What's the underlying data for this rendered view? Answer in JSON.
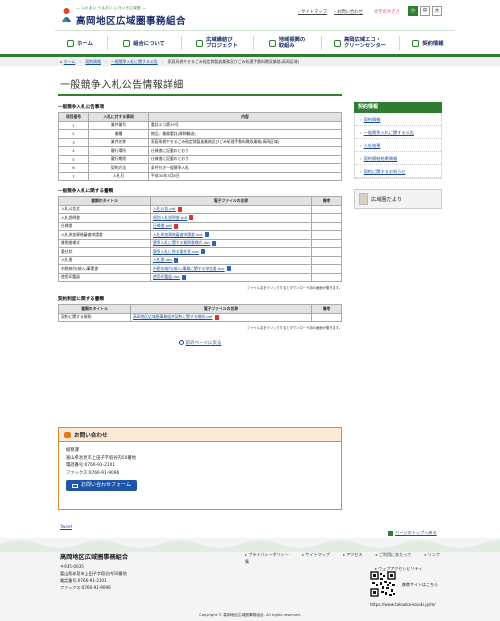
{
  "header": {
    "tagline": "― ふれあい うるおい いきいき広域圏 ―",
    "title": "高岡地区広域圏事務組合",
    "links": {
      "sitemap": "サイトマップ",
      "contact": "お問い合わせ"
    },
    "font_size_label": "文字の大きさ",
    "font_sizes": [
      "小",
      "中",
      "大"
    ]
  },
  "nav": {
    "items": [
      {
        "label": "ホーム",
        "icon": "home-icon"
      },
      {
        "label": "組合について",
        "icon": "building-icon"
      },
      {
        "label": "広域縁結び\nプロジェクト",
        "icon": "heart-icon"
      },
      {
        "label": "地域振興の\n取組み",
        "icon": "leaf-icon"
      },
      {
        "label": "高岡広域エコ・\nクリーンセンター",
        "icon": "factory-icon"
      },
      {
        "label": "契約情報",
        "icon": "handshake-icon"
      }
    ]
  },
  "breadcrumb": {
    "items": [
      "ホーム",
      "契約情報",
      "一般競争入札に関する公告",
      "家庭系燃やせるごみ指定袋製造業務及びごみ処理手数料徴収業務(高岡区域)"
    ]
  },
  "page_title": "一般競争入札公告情報詳細",
  "sections": {
    "notice": {
      "heading": "一般競争入札公告事項",
      "headers": [
        "項目番号",
        "入札に付する事項",
        "内容"
      ],
      "rows": [
        [
          "1",
          "業件番号",
          "委託エコ第29号"
        ],
        [
          "2",
          "業種",
          "物品、業務委託(貨物輸送)"
        ],
        [
          "3",
          "業件名称",
          "家庭系燃やせるごみ指定袋製造業務及びごみ処理手数料徴収業務(高岡区域)"
        ],
        [
          "4",
          "履行場所",
          "仕様書に記載のとおり"
        ],
        [
          "5",
          "履行期限",
          "仕様書に記載のとおり"
        ],
        [
          "6",
          "契約方法",
          "条件付き一般競争入札"
        ],
        [
          "7",
          "入札日",
          "平成30年3月8日"
        ]
      ]
    },
    "documents": {
      "heading": "一般競争入札に関する書類",
      "headers": [
        "書類のタイトル",
        "電子ファイルの名称",
        "備考"
      ],
      "rows": [
        {
          "title": "入札公告文",
          "file": "入札公告.pdf",
          "type": "pdf",
          "note": ""
        },
        {
          "title": "入札説明書",
          "file": "個別入札説明書.pdf",
          "type": "pdf",
          "note": ""
        },
        {
          "title": "仕様書",
          "file": "仕様書.pdf",
          "type": "pdf",
          "note": ""
        },
        {
          "title": "入札参加資格審査申請書",
          "file": "入札参加資格審査申請書.doc",
          "type": "doc",
          "note": ""
        },
        {
          "title": "質問書様式",
          "file": "競争入札に関する質問書様式.doc",
          "type": "doc",
          "note": ""
        },
        {
          "title": "委任状",
          "file": "競争入札に係る委任状.doc",
          "type": "doc",
          "note": ""
        },
        {
          "title": "入札書",
          "file": "入札書.doc",
          "type": "doc",
          "note": ""
        },
        {
          "title": "市税納付(納入)事実書",
          "file": "市税の納付(納入)事務に関する申告書.doc",
          "type": "doc",
          "note": ""
        },
        {
          "title": "使用印鑑届",
          "file": "使用印鑑届.doc",
          "type": "doc",
          "note": ""
        }
      ],
      "note": "ファイル名をクリックするとダウンロード用の画面が開きます。"
    },
    "contract": {
      "heading": "契約制度に関する書類",
      "headers": [
        "書類のタイトル",
        "電子ファイルの名称",
        "備考"
      ],
      "rows": [
        {
          "title": "契約に関する規則",
          "file": "高岡地区広域圏事務組合契約に関する規則.pdf",
          "type": "pdf",
          "note": ""
        }
      ],
      "note": "ファイル名をクリックするとダウンロード用の画面が開きます。"
    },
    "back_link": "前のページに戻る"
  },
  "sidebar": {
    "heading": "契約情報",
    "items": [
      "契約情報",
      "一般競争入札に関する公告",
      "入札結果",
      "契約締結結果情報",
      "契約に関するお知らせ"
    ],
    "banner": "広域圏だより"
  },
  "contact": {
    "heading": "お問い合わせ",
    "dept": "総務課",
    "address": "富山県氷見市上田子字宿谷内50番地",
    "tel": "電話番号:0766-91-2101",
    "fax": "ファックス:0766-91-9096",
    "button": "お問い合わせフォーム"
  },
  "tweet": "Tweet",
  "pagetop": "ページのトップへ戻る",
  "footer": {
    "name": "高岡地区広域圏事務組合",
    "address_lines": [
      "〒935-0035",
      "富山県氷見市上田子字宿谷内50番地",
      "電話番号:0766-91-2101",
      "ファックス:0766-91-9096"
    ],
    "links": [
      "プライバシーポリシー",
      "サイトマップ",
      "アクセス",
      "ご利用にあたって",
      "リンク集",
      "ウェブアクセシビリティ"
    ],
    "mobile_label": "携帯サイトはこちら",
    "url": "https://www.takaoka-kouiki.jp/m/",
    "copyright": "Copyright © 高岡地区広域圏事務組合. All rights reserved."
  },
  "colors": {
    "accent": "#2e7d32",
    "link": "#1a4b9b",
    "contact": "#e08a2e"
  }
}
